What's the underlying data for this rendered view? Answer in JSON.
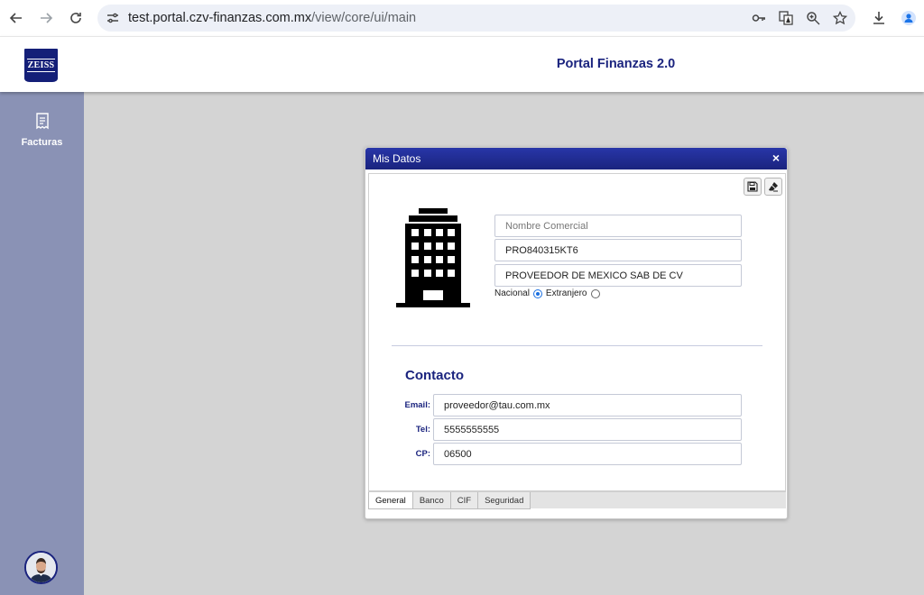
{
  "browser": {
    "url_host": "test.portal.czv-finanzas.com.mx",
    "url_path": "/view/core/ui/main",
    "icons": [
      "back-icon",
      "forward-icon",
      "reload-icon",
      "site-info-icon",
      "key-icon",
      "translate-icon",
      "zoom-icon",
      "star-icon",
      "download-icon",
      "profile-icon"
    ]
  },
  "header": {
    "logo_text": "ZEISS",
    "title": "Portal Finanzas 2.0"
  },
  "sidebar": {
    "items": [
      {
        "label": "Facturas",
        "icon": "invoice-icon"
      }
    ]
  },
  "dialog": {
    "title": "Mis Datos",
    "close": "×",
    "toolbar": {
      "save_icon": "save-icon",
      "clear_icon": "eraser-icon"
    },
    "nombre_comercial": {
      "placeholder": "Nombre Comercial",
      "value": ""
    },
    "rfc": "PRO840315KT6",
    "razon_social": "PROVEEDOR DE MEXICO SAB DE CV",
    "origen": {
      "nacional": "Nacional",
      "extranjero": "Extranjero",
      "selected": "Nacional"
    },
    "contacto": {
      "title": "Contacto",
      "email_label": "Email:",
      "email": "proveedor@tau.com.mx",
      "tel_label": "Tel:",
      "tel": "5555555555",
      "cp_label": "CP:",
      "cp": "06500"
    },
    "tabs": [
      {
        "label": "General",
        "active": true
      },
      {
        "label": "Banco",
        "active": false
      },
      {
        "label": "CIF",
        "active": false
      },
      {
        "label": "Seguridad",
        "active": false
      }
    ]
  },
  "colors": {
    "brand": "#1a237e",
    "sidebar": "#8a92b5",
    "background": "#d4d4d4"
  }
}
